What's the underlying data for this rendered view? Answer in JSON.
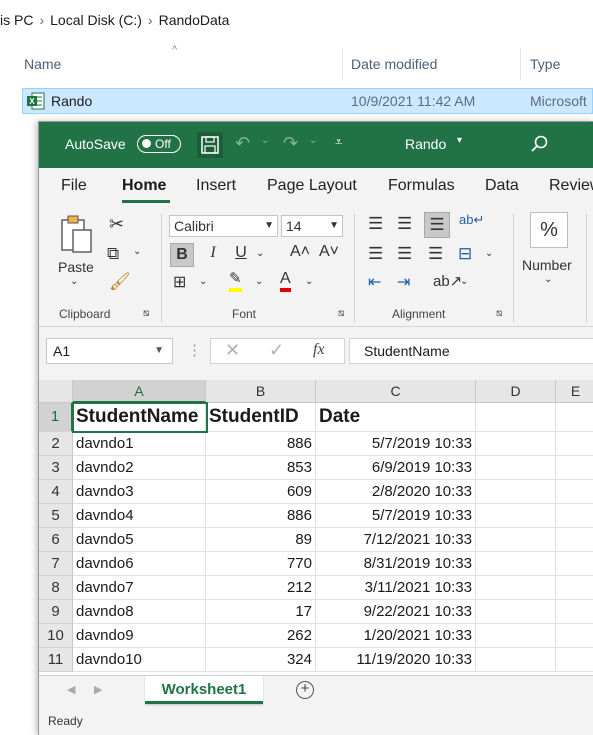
{
  "explorer": {
    "breadcrumb": [
      "is PC",
      "Local Disk (C:)",
      "RandoData"
    ],
    "columns": {
      "name": "Name",
      "date": "Date modified",
      "type": "Type"
    },
    "file": {
      "name": "Rando",
      "date": "10/9/2021 11:42 AM",
      "type": "Microsoft"
    }
  },
  "excel": {
    "autosave_label": "AutoSave",
    "autosave_state": "Off",
    "doc_title": "Rando",
    "tabs": [
      "File",
      "Home",
      "Insert",
      "Page Layout",
      "Formulas",
      "Data",
      "Review"
    ],
    "active_tab": "Home",
    "ribbon": {
      "paste_label": "Paste",
      "clipboard_label": "Clipboard",
      "font_name": "Calibri",
      "font_size": "14",
      "bold": "B",
      "italic": "I",
      "underline": "U",
      "font_label": "Font",
      "alignment_label": "Alignment",
      "number_symbol": "%",
      "number_label": "Number"
    },
    "name_box": "A1",
    "formula_value": "StudentName",
    "fx": "fx",
    "col_headers": [
      "A",
      "B",
      "C",
      "D",
      "E"
    ],
    "rows": [
      {
        "n": "1",
        "a": "StudentName",
        "b": "StudentID",
        "c": "Date"
      },
      {
        "n": "2",
        "a": "davndo1",
        "b": "886",
        "c": "5/7/2019 10:33"
      },
      {
        "n": "3",
        "a": "davndo2",
        "b": "853",
        "c": "6/9/2019 10:33"
      },
      {
        "n": "4",
        "a": "davndo3",
        "b": "609",
        "c": "2/8/2020 10:33"
      },
      {
        "n": "5",
        "a": "davndo4",
        "b": "886",
        "c": "5/7/2019 10:33"
      },
      {
        "n": "6",
        "a": "davndo5",
        "b": "89",
        "c": "7/12/2021 10:33"
      },
      {
        "n": "7",
        "a": "davndo6",
        "b": "770",
        "c": "8/31/2019 10:33"
      },
      {
        "n": "8",
        "a": "davndo7",
        "b": "212",
        "c": "3/11/2021 10:33"
      },
      {
        "n": "9",
        "a": "davndo8",
        "b": "17",
        "c": "9/22/2021 10:33"
      },
      {
        "n": "10",
        "a": "davndo9",
        "b": "262",
        "c": "1/20/2021 10:33"
      },
      {
        "n": "11",
        "a": "davndo10",
        "b": "324",
        "c": "11/19/2020 10:33"
      }
    ],
    "sheet_tab": "Worksheet1",
    "status": "Ready",
    "accent": "#217346"
  }
}
